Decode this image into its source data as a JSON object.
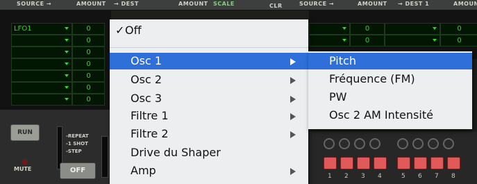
{
  "header": {
    "source_label": "SOURCE →",
    "amount_label": "AMOUNT",
    "dest_label": "→ DEST",
    "amount2_label": "AMOUNT",
    "scale_label": "SCALE",
    "clr_label": "CLR",
    "source2_label": "SOURCE →",
    "amount3_label": "AMOUNT",
    "dest1_label": "→ DEST 1",
    "amount4_label": "AMOUN"
  },
  "mod_rows": [
    {
      "source": "LFO1",
      "amount": "0"
    },
    {
      "source": "",
      "amount": "0"
    },
    {
      "source": "",
      "amount": "0"
    },
    {
      "source": "",
      "amount": "0"
    },
    {
      "source": "",
      "amount": "0"
    },
    {
      "source": "",
      "amount": "0"
    },
    {
      "source": "",
      "amount": "0"
    }
  ],
  "right_rows": [
    {
      "amount": "0",
      "amount2": "0"
    },
    {
      "amount": "0",
      "amount2": "0"
    }
  ],
  "lower": {
    "run_label": "RUN",
    "repeat_label": "-REPEAT",
    "one_shot_label": "-1 SHOT",
    "step_label": "-STEP",
    "mute_label": "MUTE",
    "off_label": "OFF"
  },
  "pads": [
    "1",
    "2",
    "3",
    "4",
    "5",
    "6",
    "7",
    "8"
  ],
  "dest_menu": {
    "items": [
      {
        "label": "Off",
        "checked": true,
        "submenu": false
      },
      {
        "label": "Osc 1",
        "checked": false,
        "submenu": true,
        "highlighted": true
      },
      {
        "label": "Osc 2",
        "checked": false,
        "submenu": true
      },
      {
        "label": "Osc 3",
        "checked": false,
        "submenu": true
      },
      {
        "label": "Filtre 1",
        "checked": false,
        "submenu": true
      },
      {
        "label": "Filtre 2",
        "checked": false,
        "submenu": true
      },
      {
        "label": "Drive du Shaper",
        "checked": false,
        "submenu": false
      },
      {
        "label": "Amp",
        "checked": false,
        "submenu": true
      }
    ]
  },
  "osc1_submenu": {
    "items": [
      {
        "label": "Pitch",
        "highlighted": true
      },
      {
        "label": "Fréquence (FM)"
      },
      {
        "label": "PW"
      },
      {
        "label": "Osc 2 AM Intensité"
      }
    ]
  },
  "colors": {
    "highlight": "#2e6fd9",
    "lcd_text": "#2dd82d",
    "pad": "#e05a5a"
  }
}
